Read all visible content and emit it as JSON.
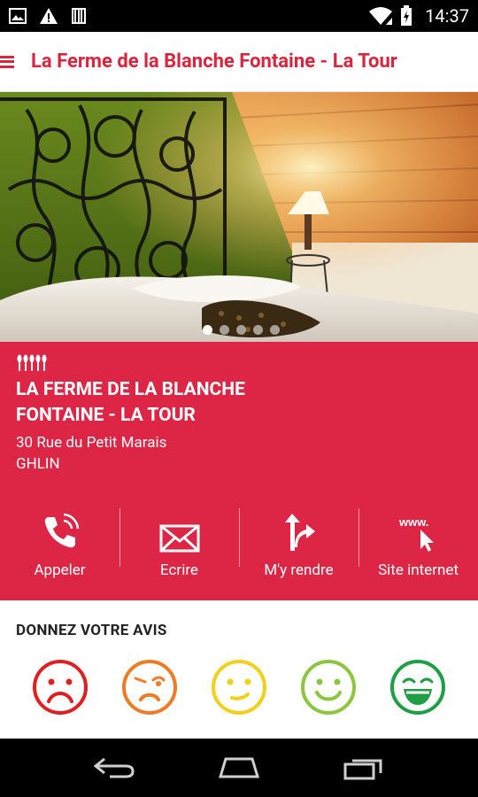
{
  "status_bar": {
    "time": "14:37",
    "icons": [
      "image-icon",
      "warning-icon",
      "barcode-icon",
      "wifi-icon",
      "battery-icon"
    ]
  },
  "app_bar": {
    "title": "La Ferme de la Blanche Fontaine - La Tour",
    "menu_icon": "menu-icon"
  },
  "gallery": {
    "image_description": "Bedroom with wrought-iron headboard",
    "dots_count": 5,
    "active_index": 0
  },
  "place": {
    "name_line1": "LA FERME DE LA BLANCHE",
    "name_line2": "FONTAINE - LA TOUR",
    "address_line1": "30 Rue du Petit Marais",
    "address_line2": "GHLIN",
    "rating_icon": "ears-of-wheat-icon"
  },
  "actions": [
    {
      "label": "Appeler",
      "icon": "phone-icon"
    },
    {
      "label": "Ecrire",
      "icon": "envelope-icon"
    },
    {
      "label": "M'y rendre",
      "icon": "directions-icon"
    },
    {
      "label": "Site internet",
      "icon": "website-icon"
    }
  ],
  "feedback": {
    "title": "DONNEZ VOTRE AVIS",
    "faces": [
      {
        "mood": "very-unhappy",
        "color": "#e02020"
      },
      {
        "mood": "unhappy",
        "color": "#ef7b25"
      },
      {
        "mood": "neutral",
        "color": "#f2d01a"
      },
      {
        "mood": "happy",
        "color": "#8cc63f"
      },
      {
        "mood": "very-happy",
        "color": "#1e9e45"
      }
    ]
  },
  "colors": {
    "brand_red": "#dd2546",
    "title_red": "#d9263e"
  }
}
